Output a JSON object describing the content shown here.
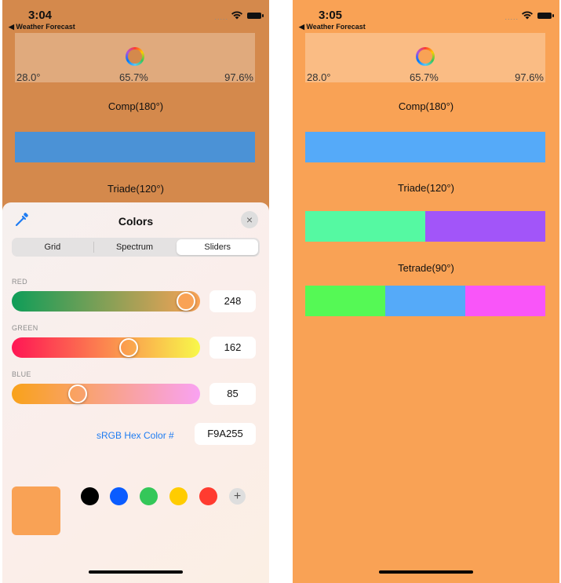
{
  "left_screen": {
    "status": {
      "time": "3:04",
      "back_label": "◀ Weather Forecast",
      "signal": "....."
    },
    "range": {
      "low": "28.0°",
      "mid": "65.7%",
      "high": "97.6%"
    },
    "sections": [
      {
        "title": "Comp(180°)",
        "colors": [
          "#4b92d6"
        ]
      },
      {
        "title": "Triade(120°)"
      }
    ],
    "sheet": {
      "title": "Colors",
      "close_icon": "×",
      "tabs": [
        {
          "label": "Grid",
          "active": false
        },
        {
          "label": "Spectrum",
          "active": false
        },
        {
          "label": "Sliders",
          "active": true
        }
      ],
      "sliders": [
        {
          "label": "RED",
          "value": "248",
          "level": 0.973,
          "gradient": [
            "#0f9d58",
            "#f9a255"
          ]
        },
        {
          "label": "GREEN",
          "value": "162",
          "level": 0.635,
          "gradient": [
            "#ff1654",
            "#f8f84a"
          ]
        },
        {
          "label": "BLUE",
          "value": "85",
          "level": 0.333,
          "gradient": [
            "#f9a21a",
            "#f9a2f2"
          ]
        }
      ],
      "hex_label": "sRGB Hex Color #",
      "hex_value": "F9A255",
      "current_color": "#f9a255",
      "palette": [
        "#000000",
        "#0a5cff",
        "#34c759",
        "#ffcc00",
        "#ff3b30"
      ],
      "add_label": "+"
    }
  },
  "right_screen": {
    "status": {
      "time": "3:05",
      "back_label": "◀ Weather Forecast",
      "signal": "....."
    },
    "background": "#f9a255",
    "range": {
      "low": "28.0°",
      "mid": "65.7%",
      "high": "97.6%"
    },
    "sections": [
      {
        "title": "Comp(180°)",
        "colors": [
          "#55aaf9"
        ]
      },
      {
        "title": "Triade(120°)",
        "colors": [
          "#55f9a2",
          "#a255f9"
        ]
      },
      {
        "title": "Tetrade(90°)",
        "colors": [
          "#55f955",
          "#55aaf9",
          "#f955f9"
        ]
      }
    ]
  }
}
